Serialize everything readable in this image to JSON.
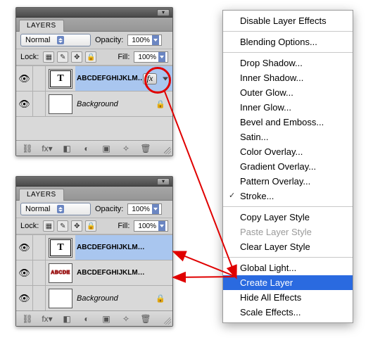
{
  "panel": {
    "title": "LAYERS",
    "blend_mode": "Normal",
    "opacity_label": "Opacity:",
    "opacity_value": "100%",
    "lock_label": "Lock:",
    "fill_label": "Fill:",
    "fill_value": "100%",
    "win_menu_glyph": "▾"
  },
  "layers_top": [
    {
      "name": "ABCDEFGHIJKLMNO...",
      "kind": "text",
      "has_fx": true,
      "locked": false,
      "selected": true
    },
    {
      "name": "Background",
      "kind": "bg",
      "has_fx": false,
      "locked": true
    }
  ],
  "layers_bottom": [
    {
      "name": "ABCDEFGHIJKLMNOPQR...",
      "kind": "text",
      "has_fx": false,
      "locked": false,
      "selected": true
    },
    {
      "name": "ABCDEFGHIJKLMNOPQRS...",
      "kind": "stroke",
      "has_fx": false,
      "locked": false
    },
    {
      "name": "Background",
      "kind": "bg",
      "has_fx": false,
      "locked": true
    }
  ],
  "bottom_icons": [
    "link",
    "fx",
    "mask",
    "adjust",
    "group",
    "new",
    "trash"
  ],
  "ctx": {
    "items": [
      {
        "t": "Disable Layer Effects",
        "kind": "n"
      },
      {
        "kind": "sep"
      },
      {
        "t": "Blending Options...",
        "kind": "n"
      },
      {
        "kind": "sep"
      },
      {
        "t": "Drop Shadow...",
        "kind": "n"
      },
      {
        "t": "Inner Shadow...",
        "kind": "n"
      },
      {
        "t": "Outer Glow...",
        "kind": "n"
      },
      {
        "t": "Inner Glow...",
        "kind": "n"
      },
      {
        "t": "Bevel and Emboss...",
        "kind": "n"
      },
      {
        "t": "Satin...",
        "kind": "n"
      },
      {
        "t": "Color Overlay...",
        "kind": "n"
      },
      {
        "t": "Gradient Overlay...",
        "kind": "n"
      },
      {
        "t": "Pattern Overlay...",
        "kind": "n"
      },
      {
        "t": "Stroke...",
        "kind": "check"
      },
      {
        "kind": "sep"
      },
      {
        "t": "Copy Layer Style",
        "kind": "n"
      },
      {
        "t": "Paste Layer Style",
        "kind": "dis"
      },
      {
        "t": "Clear Layer Style",
        "kind": "n"
      },
      {
        "kind": "sep"
      },
      {
        "t": "Global Light...",
        "kind": "n"
      },
      {
        "t": "Create Layer",
        "kind": "hl"
      },
      {
        "t": "Hide All Effects",
        "kind": "n"
      },
      {
        "t": "Scale Effects...",
        "kind": "n"
      }
    ]
  },
  "glyphs": {
    "eye": "👁",
    "lock": "🔒",
    "fx": "fx",
    "text_T": "T",
    "link": "⛓",
    "mask": "◧",
    "adjust": "◐",
    "group": "▣",
    "new": "✧",
    "trash": "🗑",
    "checker": "▦",
    "brush": "✎",
    "move": "✥"
  },
  "colors": {
    "highlight": "#2a6ae0",
    "annotation": "#e00000"
  }
}
